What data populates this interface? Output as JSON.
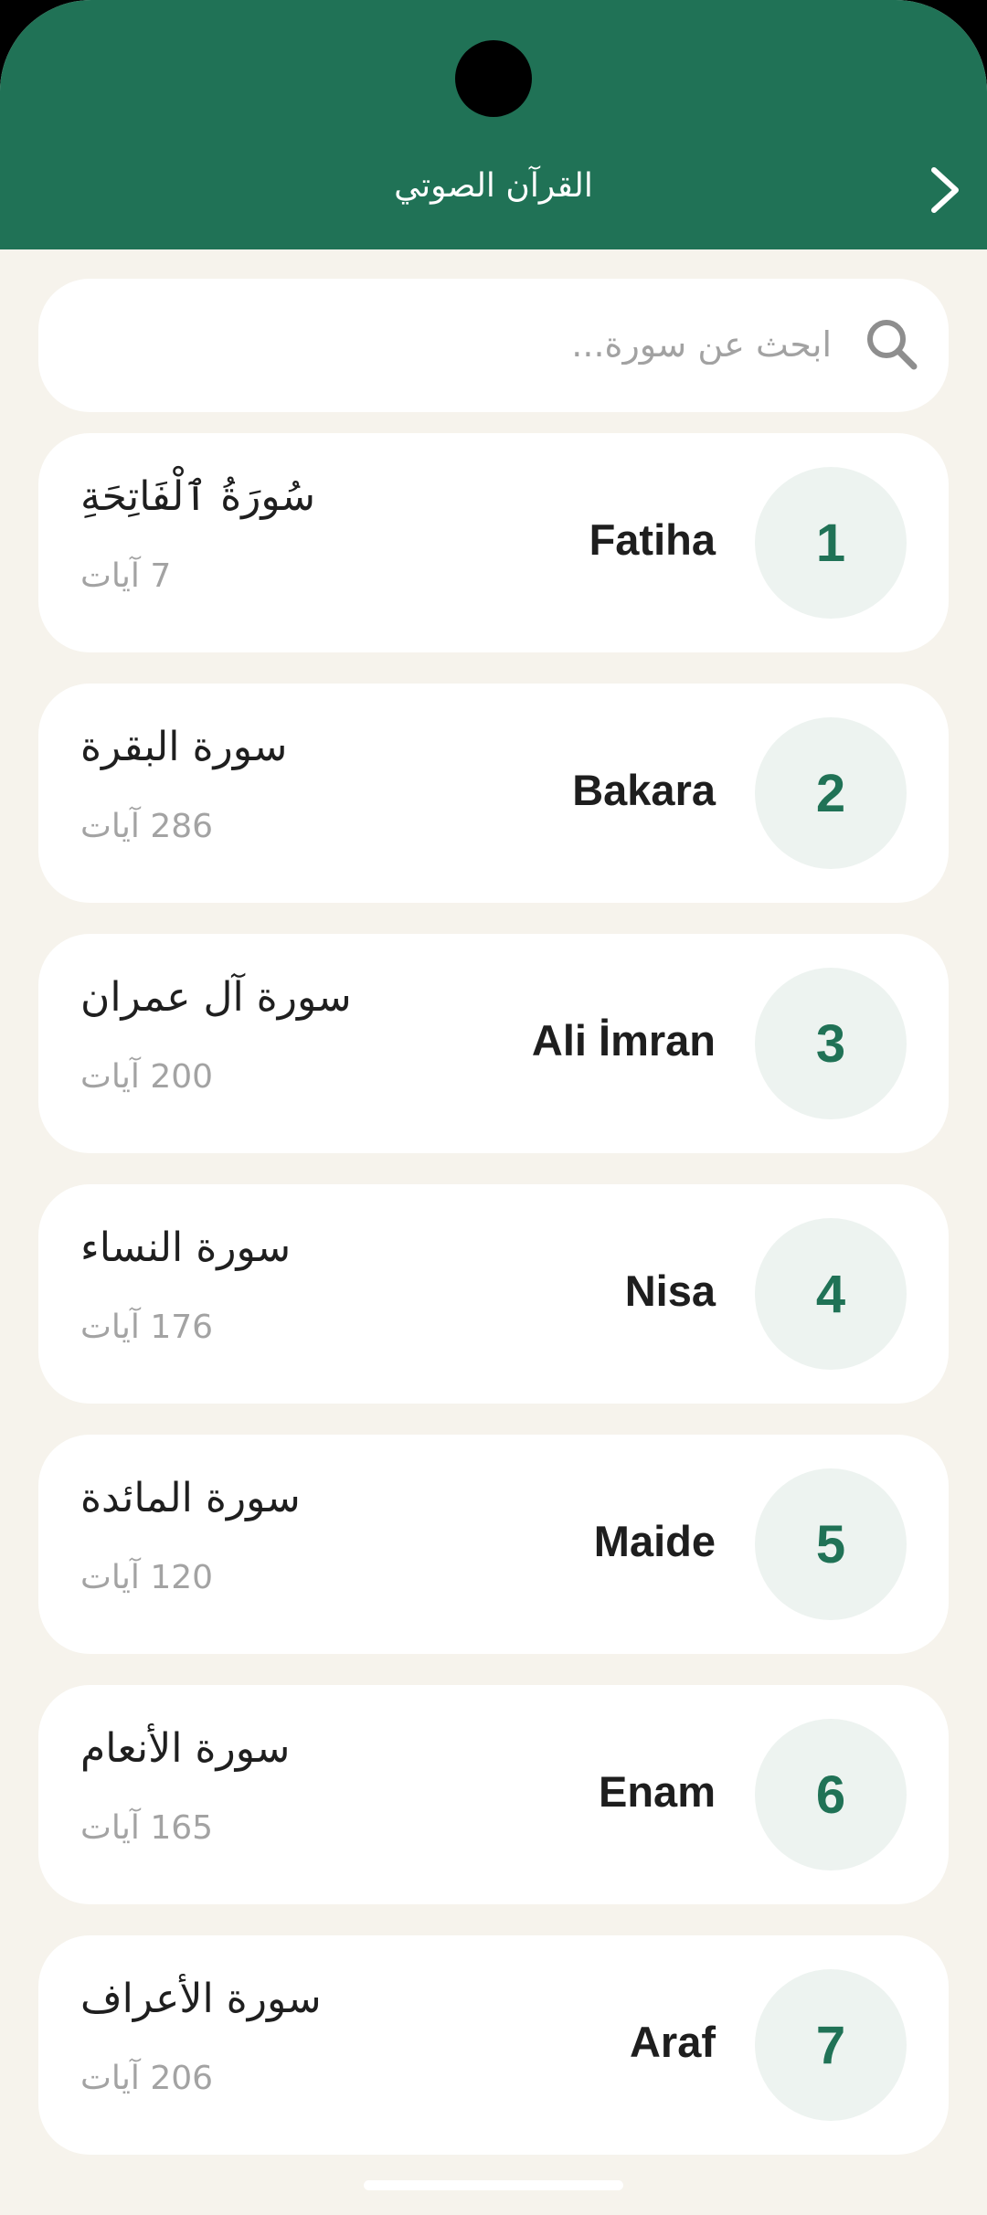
{
  "header": {
    "title": "القرآن الصوتي"
  },
  "search": {
    "placeholder": "ابحث عن سورة..."
  },
  "surahs": [
    {
      "number": "1",
      "latin_name": "Fatiha",
      "arabic_name": "سُورَةُ ٱلْفَاتِحَةِ",
      "verses": "7 آيات"
    },
    {
      "number": "2",
      "latin_name": "Bakara",
      "arabic_name": "سورة البقرة",
      "verses": "286 آيات"
    },
    {
      "number": "3",
      "latin_name": "Ali İmran",
      "arabic_name": "سورة آل عمران",
      "verses": "200 آيات"
    },
    {
      "number": "4",
      "latin_name": "Nisa",
      "arabic_name": "سورة النساء",
      "verses": "176 آيات"
    },
    {
      "number": "5",
      "latin_name": "Maide",
      "arabic_name": "سورة المائدة",
      "verses": "120 آيات"
    },
    {
      "number": "6",
      "latin_name": "Enam",
      "arabic_name": "سورة الأنعام",
      "verses": "165 آيات"
    },
    {
      "number": "7",
      "latin_name": "Araf",
      "arabic_name": "سورة الأعراف",
      "verses": "206 آيات"
    }
  ],
  "colors": {
    "primary": "#207256",
    "background": "#f6f3ec",
    "card": "#ffffff",
    "number_circle": "#edf3f0"
  },
  "icons": {
    "back": "chevron-right-icon",
    "search": "search-icon"
  }
}
